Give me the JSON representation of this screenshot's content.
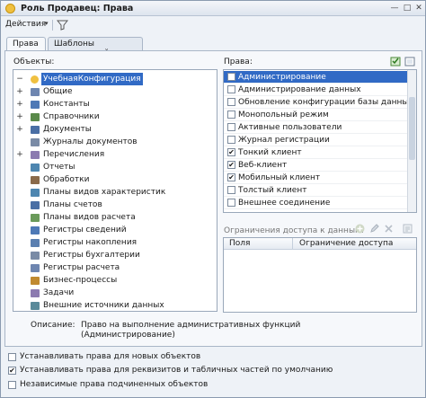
{
  "window": {
    "title": "Роль Продавец: Права"
  },
  "toolbar": {
    "actions_label": "Действия",
    "caret": "▾"
  },
  "tabs": [
    {
      "label": "Права",
      "active": true
    },
    {
      "label": "Шаблоны ограничений",
      "active": false
    }
  ],
  "objects_label": "Объекты:",
  "rights_label": "Права:",
  "tree": [
    {
      "label": "УчебнаяКонфигурация",
      "expander": "−",
      "icon": "config-icon",
      "selected": true
    },
    {
      "label": "Общие",
      "expander": "+",
      "icon": "common-folder-icon"
    },
    {
      "label": "Константы",
      "expander": "+",
      "icon": "constants-icon"
    },
    {
      "label": "Справочники",
      "expander": "+",
      "icon": "catalogs-icon"
    },
    {
      "label": "Документы",
      "expander": "+",
      "icon": "documents-icon"
    },
    {
      "label": "Журналы документов",
      "expander": "",
      "icon": "journals-icon"
    },
    {
      "label": "Перечисления",
      "expander": "+",
      "icon": "enums-icon"
    },
    {
      "label": "Отчеты",
      "expander": "",
      "icon": "reports-icon"
    },
    {
      "label": "Обработки",
      "expander": "",
      "icon": "dataprocessors-icon"
    },
    {
      "label": "Планы видов характеристик",
      "expander": "",
      "icon": "chart-of-char-types-icon"
    },
    {
      "label": "Планы счетов",
      "expander": "",
      "icon": "chart-of-accounts-icon"
    },
    {
      "label": "Планы видов расчета",
      "expander": "",
      "icon": "chart-of-calc-types-icon"
    },
    {
      "label": "Регистры сведений",
      "expander": "",
      "icon": "info-registers-icon"
    },
    {
      "label": "Регистры накопления",
      "expander": "",
      "icon": "accum-registers-icon"
    },
    {
      "label": "Регистры бухгалтерии",
      "expander": "",
      "icon": "accounting-registers-icon"
    },
    {
      "label": "Регистры расчета",
      "expander": "",
      "icon": "calc-registers-icon"
    },
    {
      "label": "Бизнес-процессы",
      "expander": "",
      "icon": "business-processes-icon"
    },
    {
      "label": "Задачи",
      "expander": "",
      "icon": "tasks-icon"
    },
    {
      "label": "Внешние источники данных",
      "expander": "",
      "icon": "external-sources-icon"
    }
  ],
  "rights": [
    {
      "label": "Администрирование",
      "checked": false,
      "selected": true
    },
    {
      "label": "Администрирование данных",
      "checked": false
    },
    {
      "label": "Обновление конфигурации базы данных",
      "checked": false
    },
    {
      "label": "Монопольный режим",
      "checked": false
    },
    {
      "label": "Активные пользователи",
      "checked": false
    },
    {
      "label": "Журнал регистрации",
      "checked": false
    },
    {
      "label": "Тонкий клиент",
      "checked": true
    },
    {
      "label": "Веб-клиент",
      "checked": true
    },
    {
      "label": "Мобильный клиент",
      "checked": true
    },
    {
      "label": "Толстый клиент",
      "checked": false
    },
    {
      "label": "Внешнее соединение",
      "checked": false
    }
  ],
  "restrictions": {
    "label": "Ограничения доступа к данным:",
    "columns": [
      "Поля",
      "Ограничение доступа"
    ]
  },
  "description": {
    "label": "Описание:",
    "text": "Право на выполнение административных функций (Администрирование)"
  },
  "options": [
    {
      "label": "Устанавливать права для новых объектов",
      "checked": false
    },
    {
      "label": "Устанавливать права для реквизитов и табличных частей по умолчанию",
      "checked": true
    },
    {
      "label": "Независимые права подчиненных объектов",
      "checked": false
    }
  ],
  "colors": {
    "selection": "#316ac5",
    "accent_yellow": "#f0c040"
  }
}
